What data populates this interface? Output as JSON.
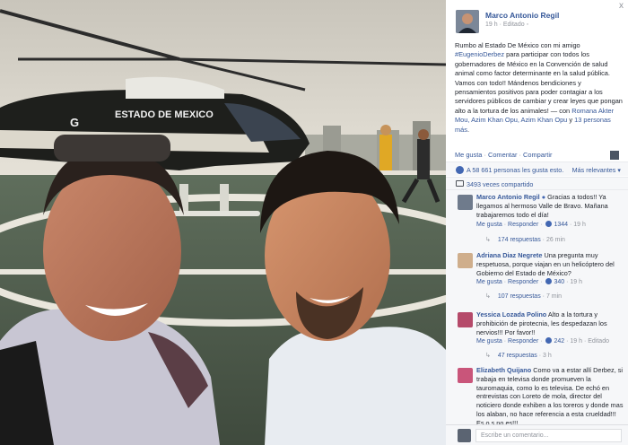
{
  "header": {
    "author": "Marco Antonio Regil",
    "time": "19 h",
    "edited": "Editado",
    "close": "x"
  },
  "photo": {
    "helicopter_text": "ESTADO DE MEXICO",
    "helicopter_letter": "G"
  },
  "post": {
    "text_1": "Rumbo al Estado De México con mi amigo ",
    "mention": "#EugenioDerbez",
    "text_2": " para participar con todos los gobernadores de México en la Convención de salud animal como factor determinante en la salud pública. Vamos con todo!! Mándenos bendiciones y pensamientos positivos para poder contagiar a los servidores públicos de cambiar y crear leyes que pongan alto a la tortura de los animales! — con ",
    "tagged": "Romana Akter Mou, Azim Khan Opu, Azim Khan Opu",
    "text_3": " y ",
    "others": "13 personas más",
    "text_4": "."
  },
  "actions": {
    "like": "Me gusta",
    "comment": "Comentar",
    "share": "Compartir"
  },
  "likes": {
    "text": "A 58 661 personas les gusta esto.",
    "relevant": "Más relevantes"
  },
  "shares": {
    "text": "3493 veces compartido"
  },
  "comments": [
    {
      "name": "Marco Antonio Regil",
      "text": "Gracias a todos!! Ya llegamos al hermoso Valle de Bravo. Mañana trabajaremos todo el día!",
      "like": "Me gusta",
      "reply": "Responder",
      "count": "1344",
      "time": "19 h",
      "replies": "174 respuestas",
      "replies_time": "26 min"
    },
    {
      "name": "Adriana Diaz Negrete",
      "text": "Una pregunta muy respetuosa, porque viajan en un helicóptero del Gobierno del Estado de México?",
      "like": "Me gusta",
      "reply": "Responder",
      "count": "340",
      "time": "19 h",
      "replies": "107 respuestas",
      "replies_time": "7 min"
    },
    {
      "name": "Yessica Lozada Polino",
      "text": "Alto a la tortura y prohibición de pirotecnia, les despedazan los nervios!!! Por favor!!",
      "like": "Me gusta",
      "reply": "Responder",
      "count": "242",
      "time": "19 h",
      "edited": "Editado",
      "replies": "47 respuestas",
      "replies_time": "3 h"
    },
    {
      "name": "Elizabeth Quijano",
      "text": "Como va a estar allí Derbez, si trabaja en televisa donde promueven la tauromaquia, como lo es televisa. De echó en entrevistas con Loreto de mola, director del noticiero donde exhiben a los toreros y donde mas los alaban, no hace referencia a esta crueldad!!! Es o s no es!!!"
    }
  ],
  "write": {
    "placeholder": "Escribe un comentario..."
  },
  "colors": {
    "link": "#365899",
    "panel_bg": "#f6f7f9",
    "like_blue": "#4267b2"
  }
}
